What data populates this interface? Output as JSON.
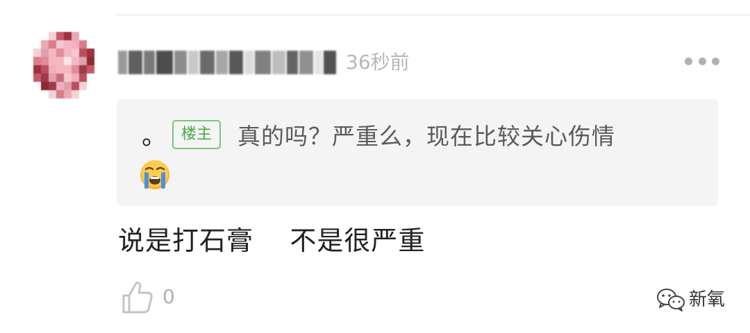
{
  "comment": {
    "timestamp": "36秒前",
    "more_icon": "more-horizontal-icon",
    "quote": {
      "prefix": "。",
      "badge": "楼主",
      "text": "真的吗？严重么，现在比较关心伤情",
      "emoji": "loudly-crying-face-emoji"
    },
    "body": "说是打石膏    不是很严重",
    "likes": {
      "icon": "thumbs-up-icon",
      "count": "0"
    }
  },
  "watermark": {
    "icon": "wechat-icon",
    "text": "新氧"
  },
  "colors": {
    "badge_green": "#4aa84a",
    "quote_bg": "#f4f4f4",
    "muted_text": "#b7b7b7"
  }
}
